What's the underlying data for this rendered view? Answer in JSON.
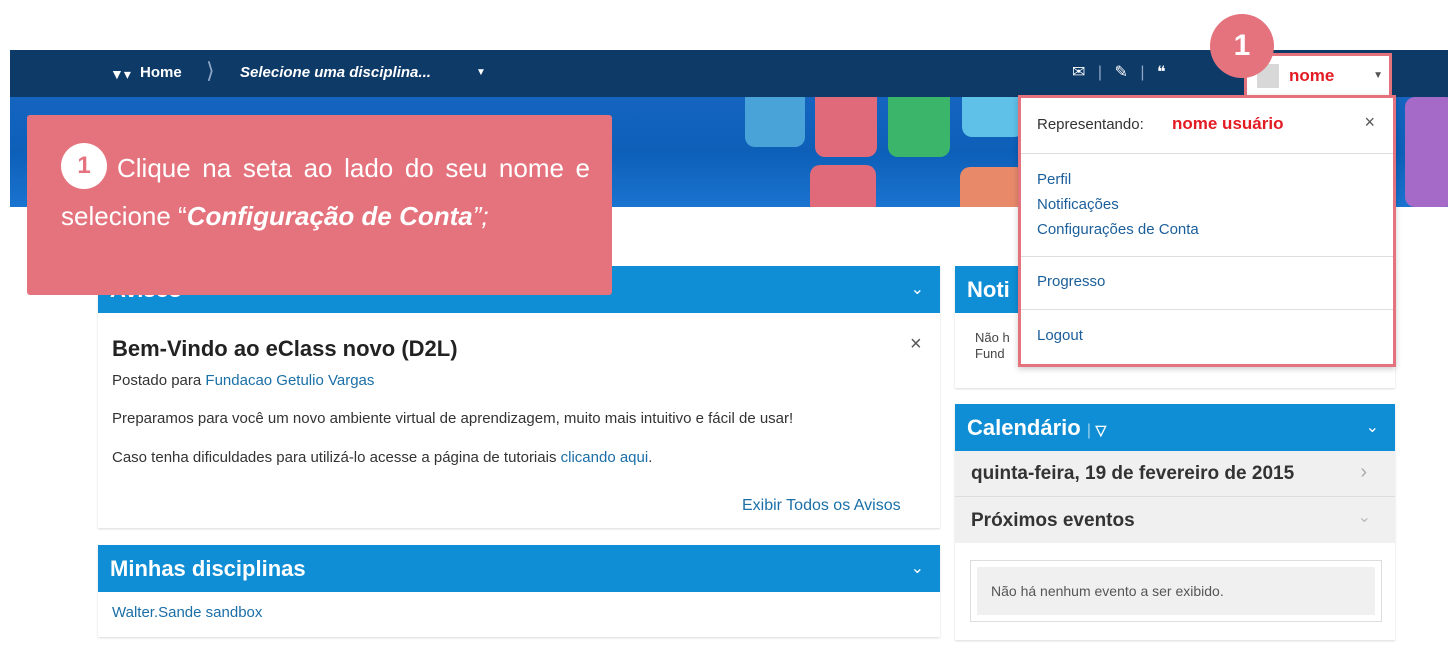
{
  "navbar": {
    "home_label": "Home",
    "course_selector": "Selecione uma disciplina...",
    "icons": [
      "mail-icon",
      "updates-icon",
      "chat-icon"
    ]
  },
  "user": {
    "name": "nome"
  },
  "dropdown": {
    "representing_label": "Representando:",
    "representing_value": "nome usuário",
    "close": "×",
    "links": [
      "Perfil",
      "Notificações",
      "Configurações de Conta"
    ],
    "progress": "Progresso",
    "logout": "Logout"
  },
  "callout": {
    "step": "1",
    "text_part1": "Clique na seta ao lado do seu nome e selecione “",
    "text_emph": "Configuração de Conta",
    "text_part2": "”;"
  },
  "step_badge": "1",
  "avisos": {
    "title": "Avisos",
    "news_title": "Bem-Vindo ao eClass novo (D2L)",
    "posted_prefix": "Postado para",
    "posted_org": "Fundacao Getulio Vargas",
    "body1": "Preparamos para você um novo ambiente virtual de aprendizagem, muito mais intuitivo e fácil de usar!",
    "body2_prefix": "Caso tenha dificuldades para utilizá-lo acesse a página de tutoriais",
    "body2_link": "clicando aqui",
    "body2_suffix": ".",
    "view_all": "Exibir Todos os Avisos"
  },
  "disciplinas": {
    "title": "Minhas disciplinas",
    "items": [
      "Walter.Sande sandbox"
    ]
  },
  "notificacoes": {
    "title": "Noti",
    "text_line1": "Não h",
    "text_line2": "Fund"
  },
  "calendario": {
    "title": "Calendário",
    "date": "quinta-feira, 19 de fevereiro de 2015",
    "upcoming": "Próximos eventos",
    "empty": "Não há nenhum evento a ser exibido."
  },
  "colors": {
    "navbar": "#0e3a68",
    "widget_header": "#0f8ed5",
    "callout": "#e5737d",
    "highlight_red": "#e31b23"
  }
}
